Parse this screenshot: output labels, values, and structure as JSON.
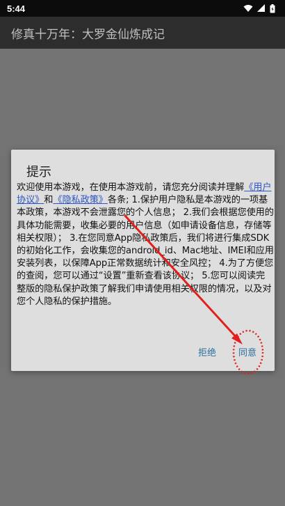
{
  "status_bar": {
    "time": "5:44",
    "icons": [
      "wifi-icon",
      "signal-icon",
      "battery-icon"
    ]
  },
  "app_bar": {
    "title": "修真十万年：大罗金仙炼成记"
  },
  "dialog": {
    "title": "提示",
    "message_part1": "欢迎使用本游戏，在使用本游戏前，请您充分阅读并理解",
    "link_user_agreement": "《用户协议》",
    "message_and": "和",
    "link_privacy_policy": "《隐私政策》",
    "message_part2": "各条; 1.保护用户隐私是本游戏的一项基本政策，本游戏不会泄露您的个人信息； 2.我们会根据您使用的具体功能需要，收集必要的用户信息（如申请设备信息，存储等相关权限）； 3.在您同意App隐私政策后，我们将进行集成SDK的初始化工作，会收集您的android_id、Mac地址、IMEI和应用安装列表，以保障App正常数据统计和安全风控； 4.为了方便您的查阅，您可以通过“设置”重新查看该协议； 5.您可以阅读完整版的隐私保护政策了解我们申请使用相关权限的情况，以及对您个人隐私的保护措施。",
    "buttons": {
      "reject": "拒绝",
      "agree": "同意"
    }
  },
  "colors": {
    "annotation": "#e0201c",
    "link": "#2b55c8",
    "button_text": "#2b6f9c"
  }
}
